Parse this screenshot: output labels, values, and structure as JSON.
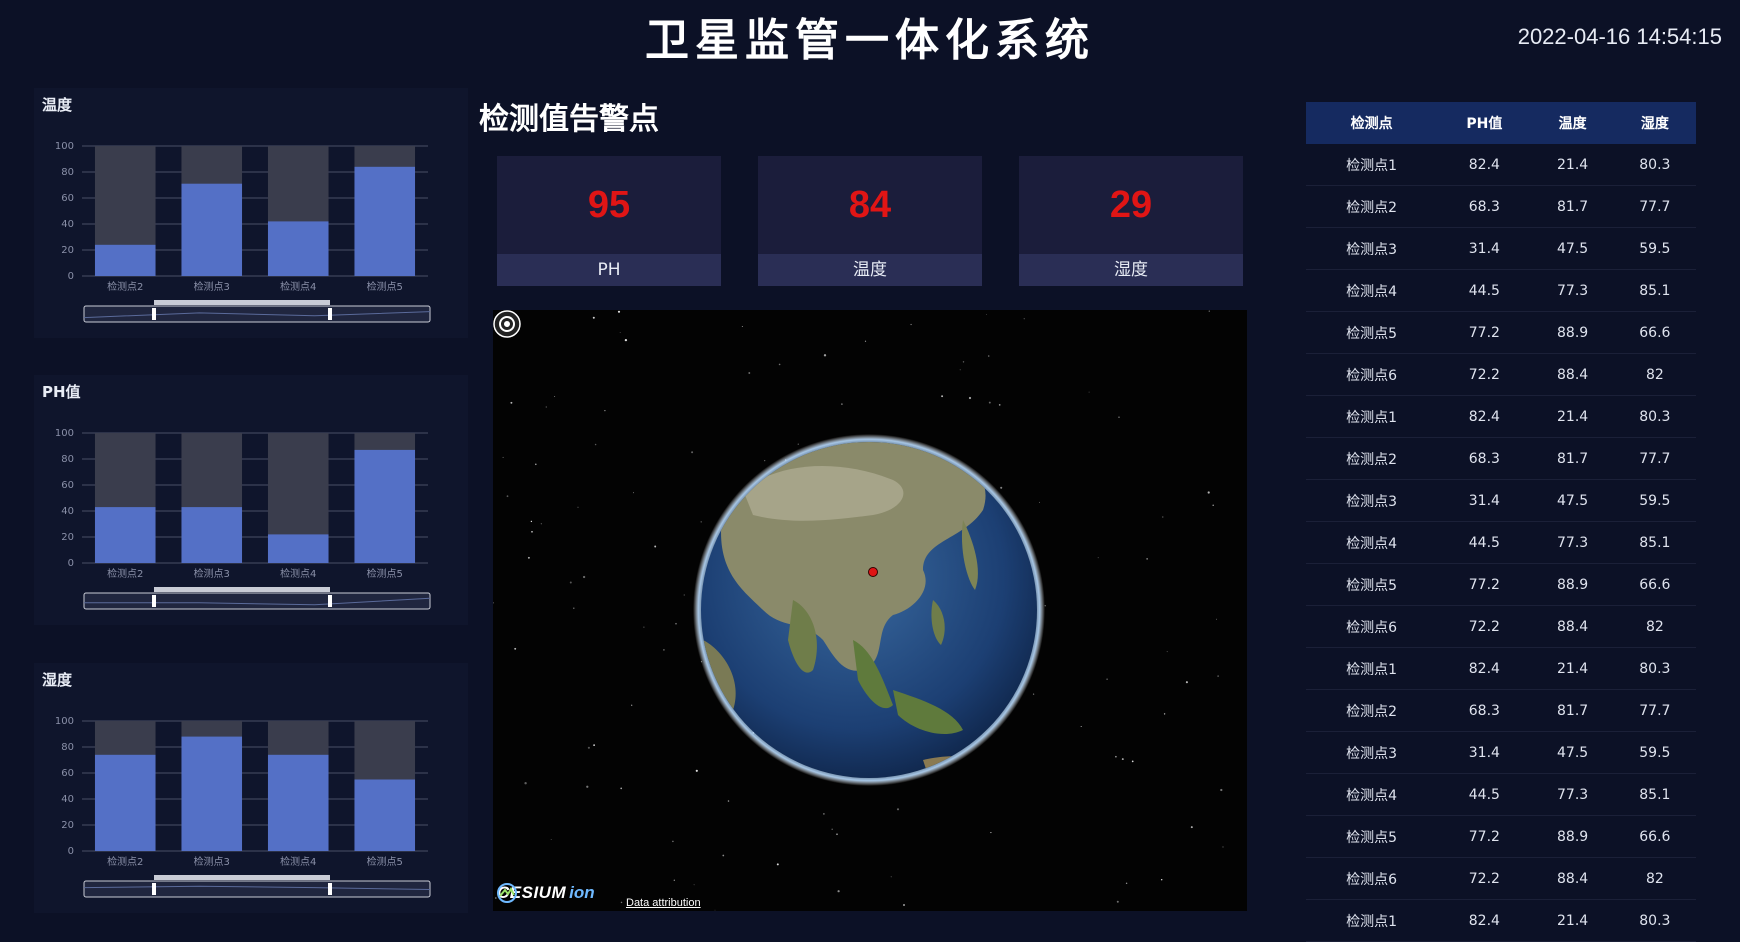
{
  "header": {
    "title": "卫星监管一体化系统",
    "datetime": "2022-04-16 14:54:15"
  },
  "charts": [
    {
      "title": "温度"
    },
    {
      "title": "PH值"
    },
    {
      "title": "湿度"
    }
  ],
  "chart_data": [
    {
      "type": "bar",
      "title": "温度",
      "categories": [
        "检测点2",
        "检测点3",
        "检测点4",
        "检测点5"
      ],
      "values": [
        24,
        71,
        42,
        84
      ],
      "ylim": [
        0,
        100
      ],
      "yticks": [
        0,
        20,
        40,
        60,
        80,
        100
      ],
      "bar_color": "#5470c6",
      "background_bar_color": "#3a3d4d"
    },
    {
      "type": "bar",
      "title": "PH值",
      "categories": [
        "检测点2",
        "检测点3",
        "检测点4",
        "检测点5"
      ],
      "values": [
        43,
        43,
        22,
        87
      ],
      "ylim": [
        0,
        100
      ],
      "yticks": [
        0,
        20,
        40,
        60,
        80,
        100
      ],
      "bar_color": "#5470c6",
      "background_bar_color": "#3a3d4d"
    },
    {
      "type": "bar",
      "title": "湿度",
      "categories": [
        "检测点2",
        "检测点3",
        "检测点4",
        "检测点5"
      ],
      "values": [
        74,
        88,
        74,
        55
      ],
      "ylim": [
        0,
        100
      ],
      "yticks": [
        0,
        20,
        40,
        60,
        80,
        100
      ],
      "bar_color": "#5470c6",
      "background_bar_color": "#3a3d4d"
    }
  ],
  "alarm": {
    "title": "检测值告警点",
    "cards": [
      {
        "value": "95",
        "label": "PH"
      },
      {
        "value": "84",
        "label": "温度"
      },
      {
        "value": "29",
        "label": "湿度"
      }
    ]
  },
  "globe": {
    "logo_main": "CESIUM",
    "logo_suffix": "ion",
    "attribution": "Data attribution",
    "marker_color": "#e01515"
  },
  "table": {
    "headers": [
      "检测点",
      "PH值",
      "温度",
      "湿度"
    ],
    "rows": [
      [
        "检测点1",
        "82.4",
        "21.4",
        "80.3"
      ],
      [
        "检测点2",
        "68.3",
        "81.7",
        "77.7"
      ],
      [
        "检测点3",
        "31.4",
        "47.5",
        "59.5"
      ],
      [
        "检测点4",
        "44.5",
        "77.3",
        "85.1"
      ],
      [
        "检测点5",
        "77.2",
        "88.9",
        "66.6"
      ],
      [
        "检测点6",
        "72.2",
        "88.4",
        "82"
      ],
      [
        "检测点1",
        "82.4",
        "21.4",
        "80.3"
      ],
      [
        "检测点2",
        "68.3",
        "81.7",
        "77.7"
      ],
      [
        "检测点3",
        "31.4",
        "47.5",
        "59.5"
      ],
      [
        "检测点4",
        "44.5",
        "77.3",
        "85.1"
      ],
      [
        "检测点5",
        "77.2",
        "88.9",
        "66.6"
      ],
      [
        "检测点6",
        "72.2",
        "88.4",
        "82"
      ],
      [
        "检测点1",
        "82.4",
        "21.4",
        "80.3"
      ],
      [
        "检测点2",
        "68.3",
        "81.7",
        "77.7"
      ],
      [
        "检测点3",
        "31.4",
        "47.5",
        "59.5"
      ],
      [
        "检测点4",
        "44.5",
        "77.3",
        "85.1"
      ],
      [
        "检测点5",
        "77.2",
        "88.9",
        "66.6"
      ],
      [
        "检测点6",
        "72.2",
        "88.4",
        "82"
      ],
      [
        "检测点1",
        "82.4",
        "21.4",
        "80.3"
      ]
    ]
  }
}
